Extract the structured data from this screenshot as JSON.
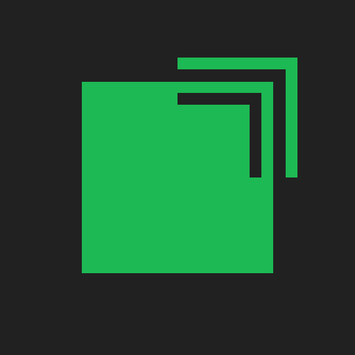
{
  "icon": {
    "name": "stacked-squares-icon",
    "colors": {
      "background": "#212121",
      "accent": "#1DB954",
      "cutout": "#212121"
    }
  }
}
